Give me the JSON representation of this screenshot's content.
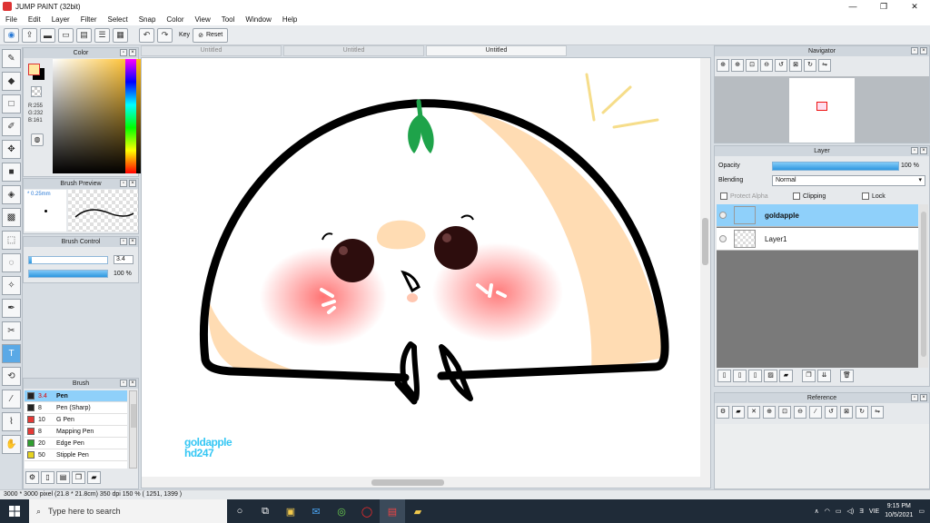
{
  "window": {
    "title": "JUMP PAINT (32bit)",
    "controls": [
      "—",
      "❐",
      "✕"
    ]
  },
  "menu": [
    "File",
    "Edit",
    "Layer",
    "Filter",
    "Select",
    "Snap",
    "Color",
    "View",
    "Tool",
    "Window",
    "Help"
  ],
  "toolbar": {
    "key_label": "Key",
    "reset_label": "Reset"
  },
  "color_panel": {
    "title": "Color",
    "rgb": [
      "R:255",
      "G:232",
      "B:161"
    ],
    "foreground": "#ffe8a1",
    "background": "#000000"
  },
  "brush_preview": {
    "title": "Brush Preview",
    "size": "* 0.25mm"
  },
  "brush_control": {
    "title": "Brush Control",
    "size_value": "3.4",
    "size_fraction": 0.03,
    "opacity_value": "100 %",
    "opacity_fraction": 1.0
  },
  "brush_panel": {
    "title": "Brush",
    "items": [
      {
        "size": "3.4",
        "name": "Pen",
        "color": "#222222",
        "selected": true
      },
      {
        "size": "8",
        "name": "Pen (Sharp)",
        "color": "#222222",
        "selected": false
      },
      {
        "size": "10",
        "name": "G Pen",
        "color": "#e53935",
        "selected": false
      },
      {
        "size": "8",
        "name": "Mapping Pen",
        "color": "#e53935",
        "selected": false
      },
      {
        "size": "20",
        "name": "Edge Pen",
        "color": "#2e9e2e",
        "selected": false
      },
      {
        "size": "50",
        "name": "Stipple Pen",
        "color": "#e6d320",
        "selected": false
      }
    ]
  },
  "doc_tabs": [
    {
      "label": "Untitled",
      "active": false
    },
    {
      "label": "Untitled",
      "active": false
    },
    {
      "label": "Untitled",
      "active": true
    }
  ],
  "canvas": {
    "watermark_line1": "goldapple",
    "watermark_line2": "hd247"
  },
  "navigator": {
    "title": "Navigator"
  },
  "layer_panel": {
    "title": "Layer",
    "opacity_label": "Opacity",
    "opacity_value": "100 %",
    "blending_label": "Blending",
    "blending_value": "Normal",
    "protect_alpha": "Protect Alpha",
    "clipping": "Clipping",
    "lock": "Lock",
    "layers": [
      {
        "name": "goldapple",
        "selected": true
      },
      {
        "name": "Layer1",
        "selected": false
      }
    ]
  },
  "reference": {
    "title": "Reference"
  },
  "status": "3000 * 3000 pixel   (21.8 * 21.8cm)   350 dpi   150 %   ( 1251, 1399 )",
  "taskbar": {
    "search_placeholder": "Type here to search",
    "language": "VIE",
    "time": "9:15 PM",
    "date": "10/5/2021"
  }
}
